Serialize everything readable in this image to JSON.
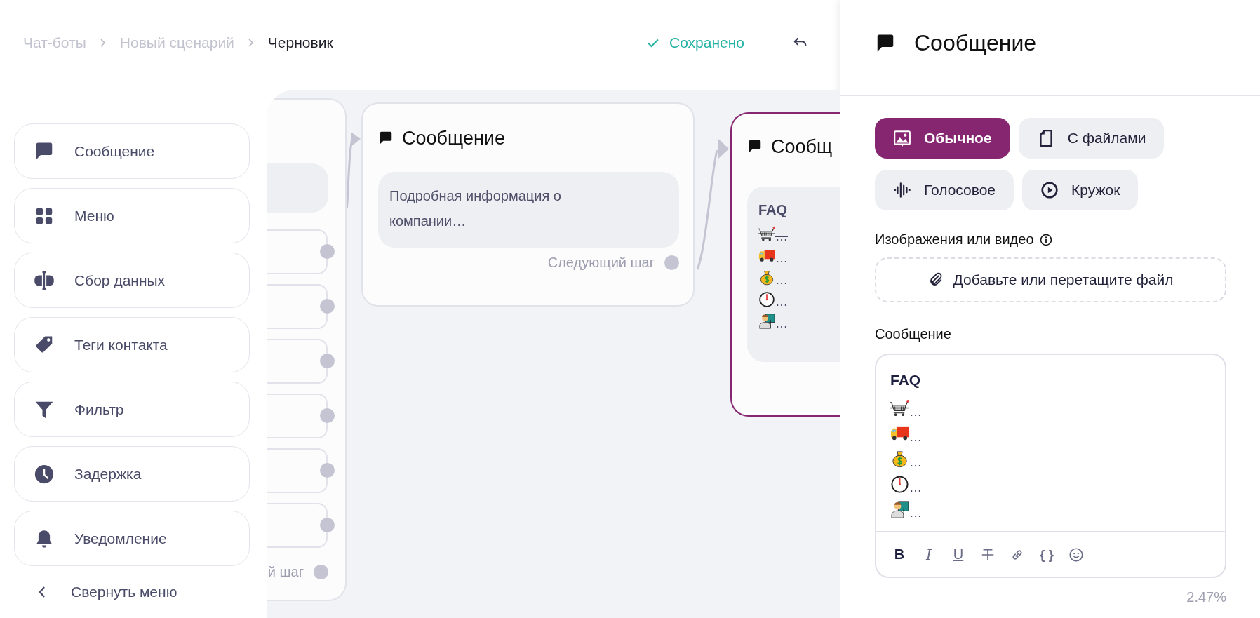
{
  "breadcrumbs": [
    {
      "label": "Чат-боты",
      "current": false
    },
    {
      "label": "Новый сценарий",
      "current": false
    },
    {
      "label": "Черновик",
      "current": true
    }
  ],
  "save_status": {
    "label": "Сохранено"
  },
  "sidebar": {
    "items": [
      {
        "kind": "message",
        "label": "Сообщение"
      },
      {
        "kind": "menu",
        "label": "Меню"
      },
      {
        "kind": "data",
        "label": "Сбор данных"
      },
      {
        "kind": "tags",
        "label": "Теги контакта"
      },
      {
        "kind": "filter",
        "label": "Фильтр"
      },
      {
        "kind": "delay",
        "label": "Задержка"
      },
      {
        "kind": "notification",
        "label": "Уведомление"
      }
    ],
    "collapse": {
      "label": "Свернуть меню"
    }
  },
  "canvas": {
    "nodes": [
      {
        "kind": "menu",
        "buttons": [
          {
            "kind": "button"
          },
          {
            "kind": "button"
          },
          {
            "kind": "button"
          },
          {
            "kind": "button"
          },
          {
            "kind": "button"
          },
          {
            "kind": "button"
          }
        ],
        "next_label": "й шаг",
        "selected": false
      },
      {
        "kind": "message",
        "title": "Сообщение",
        "text": "Подробная информация о компании…",
        "next_label": "Следующий шаг",
        "selected": false
      },
      {
        "kind": "message",
        "title": "Сообщ",
        "content": {
          "heading": "FAQ",
          "lines": [
            {
              "kind": "cart",
              "text": "…",
              "strike": true
            },
            {
              "kind": "truck",
              "text": "…",
              "strike": false
            },
            {
              "kind": "money",
              "text": "…",
              "strike": false
            },
            {
              "kind": "stopwatch",
              "text": "…",
              "strike": false
            },
            {
              "kind": "teacher",
              "text": "…",
              "strike": false
            }
          ]
        },
        "selected": true
      }
    ]
  },
  "panel": {
    "title": "Сообщение",
    "modes": [
      {
        "kind": "image",
        "label": "Обычное",
        "selected": true
      },
      {
        "kind": "file",
        "label": "С файлами",
        "selected": false
      },
      {
        "kind": "voice",
        "label": "Голосовое",
        "selected": false
      },
      {
        "kind": "circle",
        "label": "Кружок",
        "selected": false
      }
    ],
    "media_label": "Изображения или видео",
    "dropzone": "Добавьте или перетащите файл",
    "message_label": "Сообщение",
    "editor": {
      "heading": "FAQ",
      "lines": [
        {
          "kind": "cart",
          "text": "…",
          "strike": true
        },
        {
          "kind": "truck",
          "text": "…",
          "strike": false
        },
        {
          "kind": "money",
          "text": "…",
          "strike": false
        },
        {
          "kind": "stopwatch",
          "text": "…",
          "strike": false
        },
        {
          "kind": "teacher",
          "text": "…",
          "strike": false
        }
      ],
      "toolbar": [
        {
          "kind": "bold",
          "label": "B"
        },
        {
          "kind": "italic",
          "label": "I"
        },
        {
          "kind": "underline",
          "label": "U"
        },
        {
          "kind": "strike"
        },
        {
          "kind": "link"
        },
        {
          "kind": "variable",
          "label": "{ }"
        },
        {
          "kind": "emoji"
        }
      ]
    },
    "usage": "2.47%"
  }
}
